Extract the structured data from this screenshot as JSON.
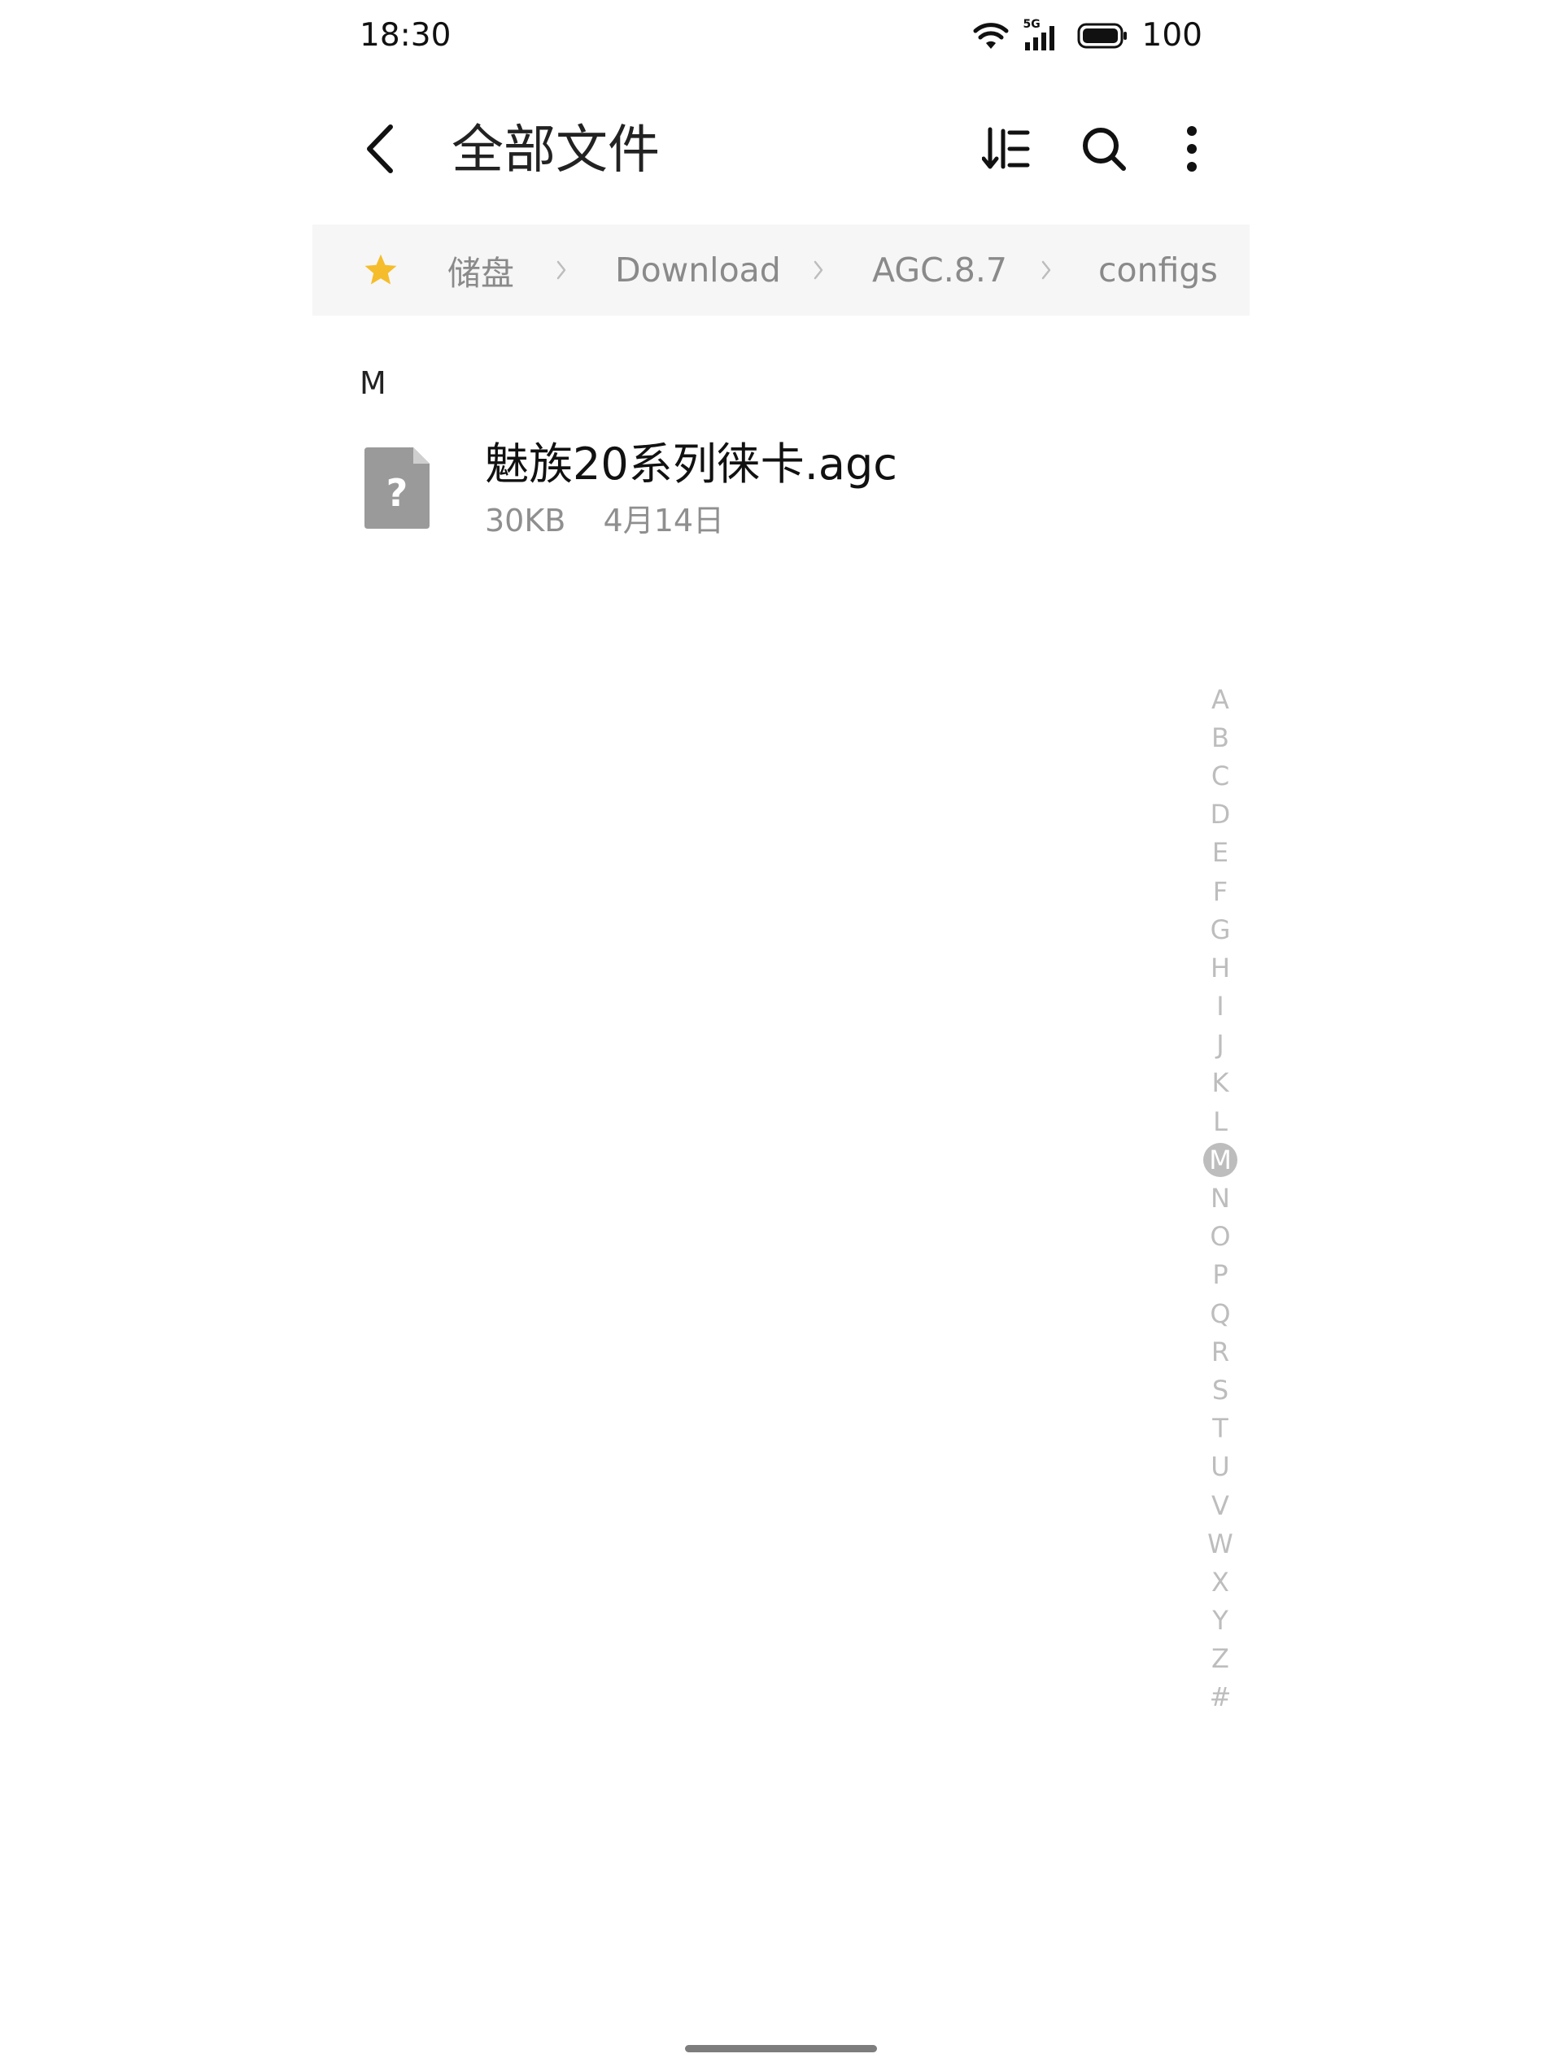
{
  "status_bar": {
    "time": "18:30",
    "network_label": "5G",
    "battery_percent": "100",
    "icons": [
      "wifi-icon",
      "cellular-5g-icon",
      "battery-icon"
    ]
  },
  "header": {
    "title": "全部文件",
    "icons": [
      "back-arrow-icon",
      "sort-icon",
      "search-icon",
      "more-vertical-icon"
    ]
  },
  "breadcrumb": {
    "icons": [
      "star-icon",
      "chevron-right-icon"
    ],
    "star_color": "#F5BD2C",
    "items": [
      {
        "label": "储盘"
      },
      {
        "label": "Download"
      },
      {
        "label": "AGC.8.7"
      },
      {
        "label": "configs"
      }
    ]
  },
  "section": {
    "letter": "M"
  },
  "files": [
    {
      "name": "魅族20系列徕卡.agc",
      "size": "30KB",
      "date": "4月14日",
      "icon": "unknown-file-icon"
    }
  ],
  "alphabet_index": {
    "letters": [
      "A",
      "B",
      "C",
      "D",
      "E",
      "F",
      "G",
      "H",
      "I",
      "J",
      "K",
      "L",
      "M",
      "N",
      "O",
      "P",
      "Q",
      "R",
      "S",
      "T",
      "U",
      "V",
      "W",
      "X",
      "Y",
      "Z",
      "#"
    ],
    "active": "M"
  }
}
